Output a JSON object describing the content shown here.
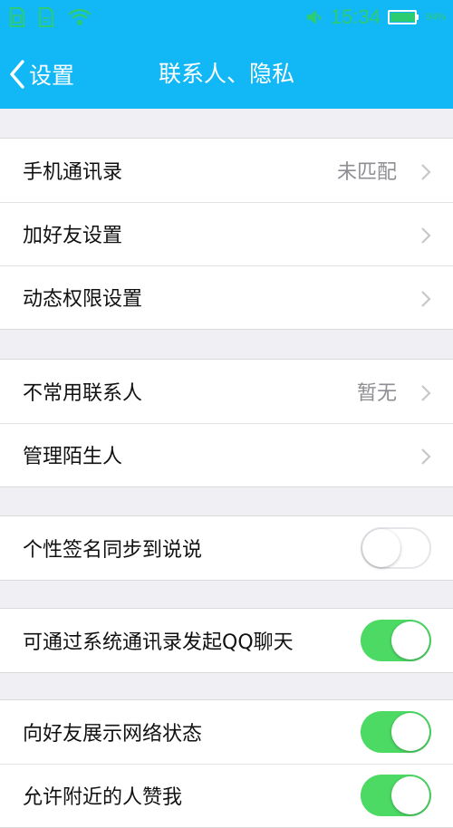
{
  "status_bar": {
    "time": "15:34",
    "battery_percent": "94%",
    "icons": [
      "sim-icon",
      "sms-icon",
      "wifi-icon",
      "mute-icon",
      "battery-icon"
    ]
  },
  "nav": {
    "back_label": "设置",
    "title": "联系人、隐私"
  },
  "colors": {
    "header": "#12b7f5",
    "toggle_on": "#4cd964",
    "background": "#efeff4"
  },
  "groups": [
    {
      "rows": [
        {
          "label": "手机通讯录",
          "value": "未匹配"
        },
        {
          "label": "加好友设置"
        },
        {
          "label": "动态权限设置"
        }
      ]
    },
    {
      "rows": [
        {
          "label": "不常用联系人",
          "value": "暂无"
        },
        {
          "label": "管理陌生人"
        }
      ]
    },
    {
      "rows": [
        {
          "label": "个性签名同步到说说",
          "toggle": false
        }
      ]
    },
    {
      "rows": [
        {
          "label": "可通过系统通讯录发起QQ聊天",
          "toggle": true
        }
      ]
    },
    {
      "rows": [
        {
          "label": "向好友展示网络状态",
          "toggle": true
        },
        {
          "label": "允许附近的人赞我",
          "toggle": true
        }
      ]
    }
  ]
}
